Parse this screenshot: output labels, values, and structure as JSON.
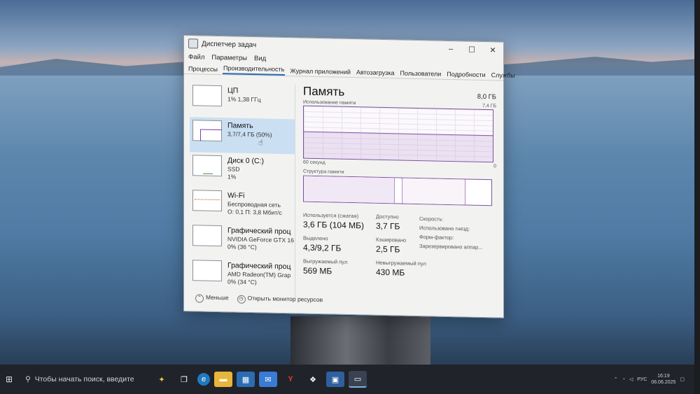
{
  "window": {
    "title": "Диспетчер задач",
    "minimize": "–",
    "maximize": "☐",
    "close": "✕"
  },
  "menu": [
    "Файл",
    "Параметры",
    "Вид"
  ],
  "tabs": [
    {
      "label": "Процессы",
      "active": false
    },
    {
      "label": "Производительность",
      "active": true
    },
    {
      "label": "Журнал приложений",
      "active": false
    },
    {
      "label": "Автозагрузка",
      "active": false
    },
    {
      "label": "Пользователи",
      "active": false
    },
    {
      "label": "Подробности",
      "active": false
    },
    {
      "label": "Службы",
      "active": false
    }
  ],
  "left_panel": [
    {
      "name": "ЦП",
      "line1": "1%  1,38 ГГц",
      "line2": ""
    },
    {
      "name": "Память",
      "line1": "3,7/7,4 ГБ (50%)",
      "line2": ""
    },
    {
      "name": "Диск 0 (C:)",
      "line1": "SSD",
      "line2": "1%"
    },
    {
      "name": "Wi-Fi",
      "line1": "Беспроводная сеть",
      "line2": "О: 0,1  П: 3,8 Мбит/с"
    },
    {
      "name": "Графический проц",
      "line1": "NVIDIA GeForce GTX 16",
      "line2": "0% (36 °C)"
    },
    {
      "name": "Графический проц",
      "line1": "AMD Radeon(TM) Grap",
      "line2": "0% (34 °C)"
    }
  ],
  "memory": {
    "title": "Память",
    "total": "8,0 ГБ",
    "usage_label": "Использование памяти",
    "usage_max": "7,4 ГБ",
    "usage_fraction": 0.5,
    "time_label": "60 секунд",
    "zero_label": "0",
    "structure_label": "Структура памяти",
    "stats": {
      "in_use_label": "Используется (сжатая)",
      "in_use_value": "3,6 ГБ (104 МБ)",
      "available_label": "Доступно",
      "available_value": "3,7 ГБ",
      "committed_label": "Выделено",
      "committed_value": "4,3/9,2 ГБ",
      "cached_label": "Кэшировано",
      "cached_value": "2,5 ГБ",
      "paged_label": "Выгружаемый пул",
      "paged_value": "569 МБ",
      "nonpaged_label": "Невыгружаемый пул",
      "nonpaged_value": "430 МБ"
    },
    "props": [
      "Скорость:",
      "Использовано гнезд:",
      "Форм-фактор:",
      "Зарезервировано аппар..."
    ]
  },
  "footer": {
    "less": "Меньше",
    "resmon": "Открыть монитор ресурсов"
  },
  "taskbar": {
    "search_placeholder": "Чтобы начать поиск, введите",
    "tray_lang": "РУС",
    "time": "16:19",
    "date": "06.06.2025"
  },
  "colors": {
    "memory_accent": "#8a58ad",
    "selection": "#cbdff2",
    "taskbar": "#20232a"
  }
}
